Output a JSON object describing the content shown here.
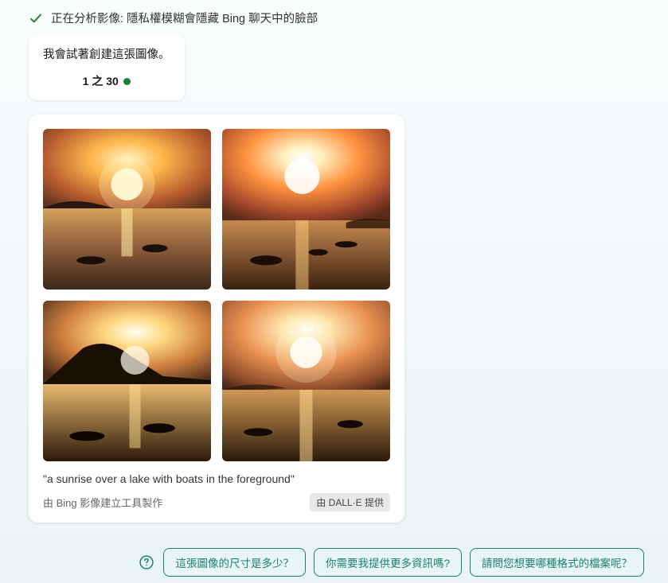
{
  "status": {
    "text": "正在分析影像: 隱私權模糊會隱藏 Bing 聊天中的臉部"
  },
  "response": {
    "text": "我會試著創建這張圖像。",
    "counter": "1 之 30"
  },
  "imageCard": {
    "prompt": "\"a sunrise over a lake with boats in the foreground\"",
    "credit": "由 Bing 影像建立工具製作",
    "dalle": "由 DALL·E 提供"
  },
  "suggestions": [
    "這張圖像的尺寸是多少？",
    "你需要我提供更多資訊嗎?",
    "請問您想要哪種格式的檔案呢？"
  ]
}
